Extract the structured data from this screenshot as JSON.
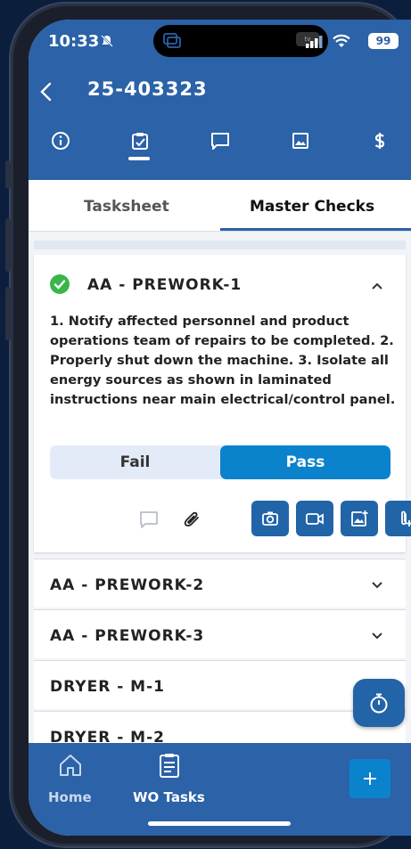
{
  "status_bar": {
    "time": "10:33",
    "battery": "99",
    "island_tv": "tv"
  },
  "header": {
    "title": "25-403323"
  },
  "icon_tabs": [
    {
      "icon": "info-icon"
    },
    {
      "icon": "checklist-icon",
      "active": true
    },
    {
      "icon": "comment-icon"
    },
    {
      "icon": "image-icon"
    },
    {
      "icon": "dollar-icon"
    }
  ],
  "sub_tabs": {
    "tasksheet": "Tasksheet",
    "master_checks": "Master Checks",
    "active": "Master Checks"
  },
  "expanded_item": {
    "title": "AA - PREWORK-1",
    "status": "passed",
    "description": "1. Notify affected personnel and product operations team of repairs to be completed.  2. Properly shut down the machine.  3. Isolate all energy sources as shown in laminated instructions near main electrical/control panel.",
    "fail_label": "Fail",
    "pass_label": "Pass",
    "selected": "Pass"
  },
  "items": [
    {
      "label": "AA - PREWORK-2"
    },
    {
      "label": "AA - PREWORK-3"
    },
    {
      "label": "DRYER - M-1"
    },
    {
      "label": "DRYER - M-2"
    }
  ],
  "bottom_nav": {
    "home": "Home",
    "wo_tasks": "WO Tasks"
  },
  "colors": {
    "header": "#2b62a8",
    "accent": "#0b82cc",
    "button": "#2264a8",
    "check": "#3bb54a"
  }
}
